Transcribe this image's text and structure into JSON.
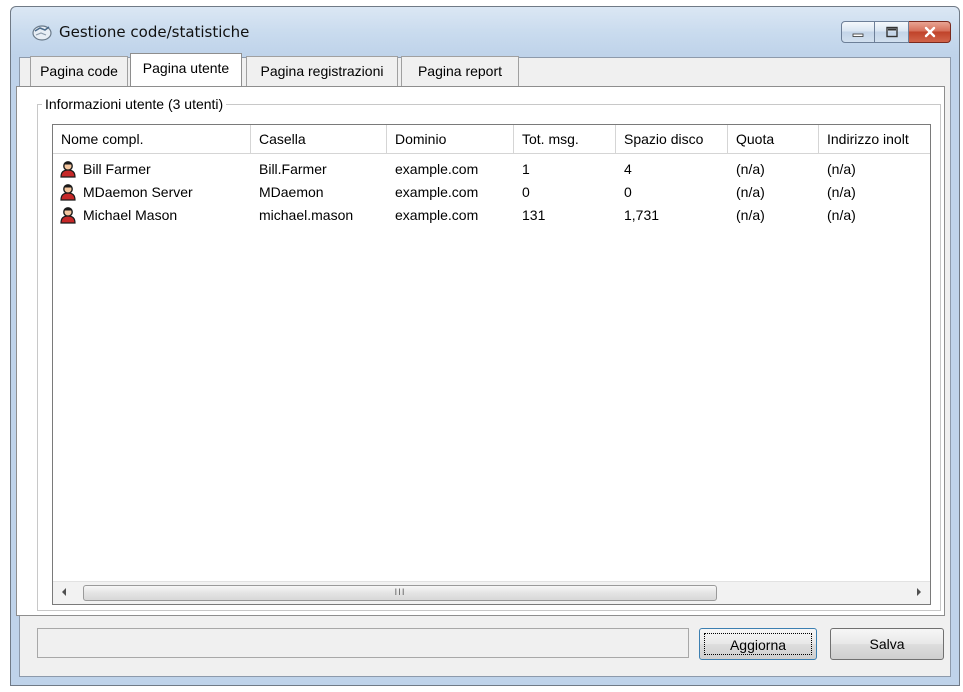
{
  "window": {
    "title": "Gestione code/statistiche",
    "controls": {
      "minimize": "minimize-icon",
      "maximize": "maximize-icon",
      "close": "close-icon"
    }
  },
  "tabs": [
    {
      "label": "Pagina code",
      "active": false
    },
    {
      "label": "Pagina utente",
      "active": true
    },
    {
      "label": "Pagina registrazioni",
      "active": false
    },
    {
      "label": "Pagina report",
      "active": false
    }
  ],
  "group": {
    "label": "Informazioni utente (3 utenti)"
  },
  "table": {
    "columns": [
      "Nome compl.",
      "Casella",
      "Dominio",
      "Tot. msg.",
      "Spazio disco",
      "Quota",
      "Indirizzo inolt"
    ],
    "rows": [
      [
        "Bill Farmer",
        "Bill.Farmer",
        "example.com",
        "1",
        "4",
        "(n/a)",
        "(n/a)"
      ],
      [
        "MDaemon Server",
        "MDaemon",
        "example.com",
        "0",
        "0",
        "(n/a)",
        "(n/a)"
      ],
      [
        "Michael Mason",
        "michael.mason",
        "example.com",
        "131",
        "1,731",
        "(n/a)",
        "(n/a)"
      ]
    ],
    "row_icon": "user-icon"
  },
  "scrollbar": {
    "grip": "III"
  },
  "status_text": "",
  "buttons": {
    "refresh": "Aggiorna",
    "save": "Salva"
  },
  "colors": {
    "title_bar": "#bfd3ea",
    "close_button": "#c0432a",
    "focus_border": "#3c7fb1"
  }
}
